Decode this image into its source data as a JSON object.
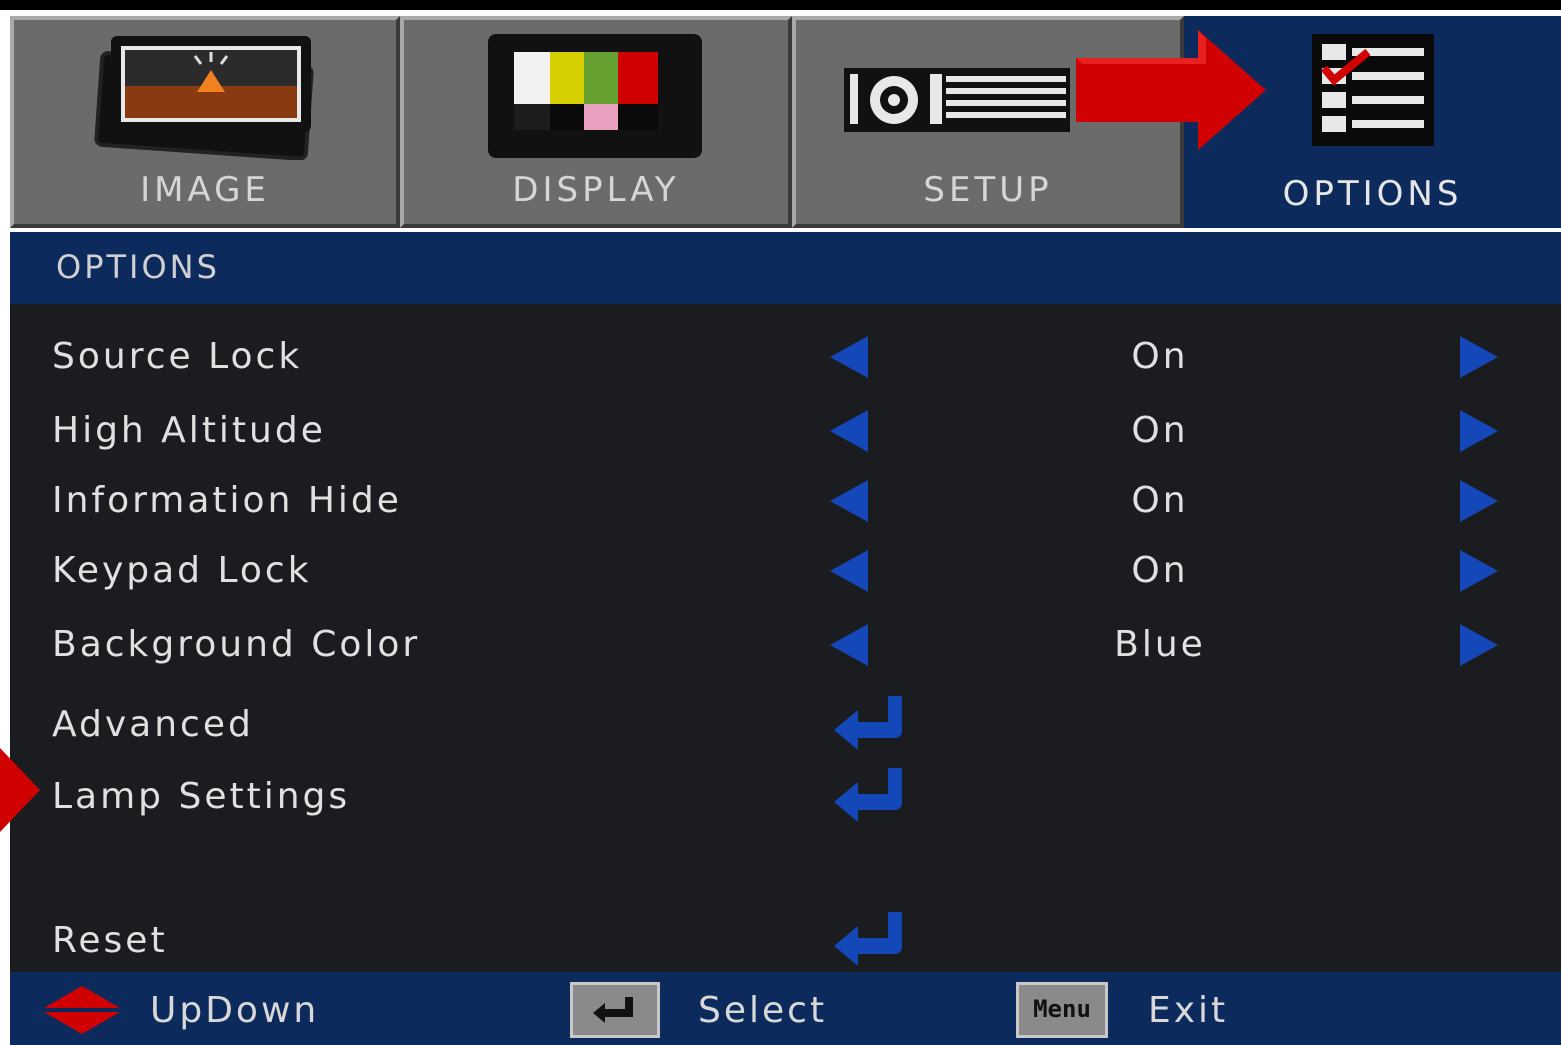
{
  "tabs": [
    {
      "id": "image",
      "label": "IMAGE",
      "icon": "image-icon",
      "active": false
    },
    {
      "id": "display",
      "label": "DISPLAY",
      "icon": "display-color-bars-icon",
      "active": false
    },
    {
      "id": "setup",
      "label": "SETUP",
      "icon": "projector-icon",
      "active": false
    },
    {
      "id": "options",
      "label": "OPTIONS",
      "icon": "checklist-icon",
      "active": true
    }
  ],
  "section": {
    "title": "OPTIONS"
  },
  "menu": {
    "items": [
      {
        "label": "Source Lock",
        "type": "selector",
        "value": "On"
      },
      {
        "label": "High Altitude",
        "type": "selector",
        "value": "On"
      },
      {
        "label": "Information Hide",
        "type": "selector",
        "value": "On"
      },
      {
        "label": "Keypad Lock",
        "type": "selector",
        "value": "On"
      },
      {
        "label": "Background Color",
        "type": "selector",
        "value": "Blue"
      },
      {
        "label": "Advanced",
        "type": "submenu",
        "icon": "enter-icon"
      },
      {
        "label": "Lamp Settings",
        "type": "submenu",
        "icon": "enter-icon"
      },
      {
        "label": "Reset",
        "type": "submenu",
        "icon": "enter-icon"
      }
    ]
  },
  "footer": {
    "updown_label": "UpDown",
    "select_label": "Select",
    "menu_key_label": "Menu",
    "exit_label": "Exit"
  },
  "colors": {
    "panel_blue": "#0d2a5c",
    "arrow_blue": "#1448b8",
    "pointer_red": "#d00000",
    "menu_bg": "#1a1c20"
  }
}
